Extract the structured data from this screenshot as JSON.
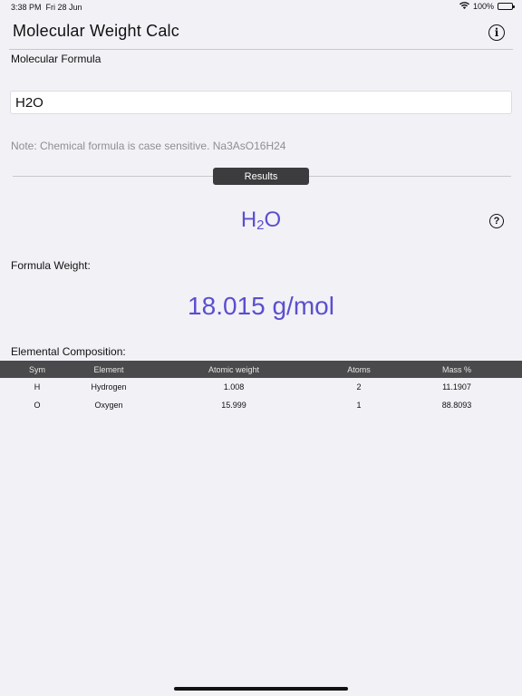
{
  "status_bar": {
    "time": "3:38 PM",
    "date": "Fri 28 Jun",
    "battery": "100%"
  },
  "nav": {
    "title": "Molecular Weight Calc"
  },
  "input": {
    "label": "Molecular Formula",
    "value": "H2O",
    "note": "Note: Chemical formula is case sensitive. Na3AsO16H24"
  },
  "results": {
    "button_label": "Results",
    "formula_base": "H",
    "formula_sub": "2",
    "formula_tail": "O",
    "weight_label": "Formula Weight:",
    "weight_value": "18.015 g/mol",
    "composition_label": "Elemental Composition:"
  },
  "table": {
    "headers": [
      "Sym",
      "Element",
      "Atomic weight",
      "Atoms",
      "Mass %"
    ],
    "rows": [
      [
        "H",
        "Hydrogen",
        "1.008",
        "2",
        "11.1907"
      ],
      [
        "O",
        "Oxygen",
        "15.999",
        "1",
        "88.8093"
      ]
    ]
  },
  "colors": {
    "accent": "#5a4fcf",
    "header_bg": "#4a4a4c",
    "background": "#f2f1f6"
  }
}
